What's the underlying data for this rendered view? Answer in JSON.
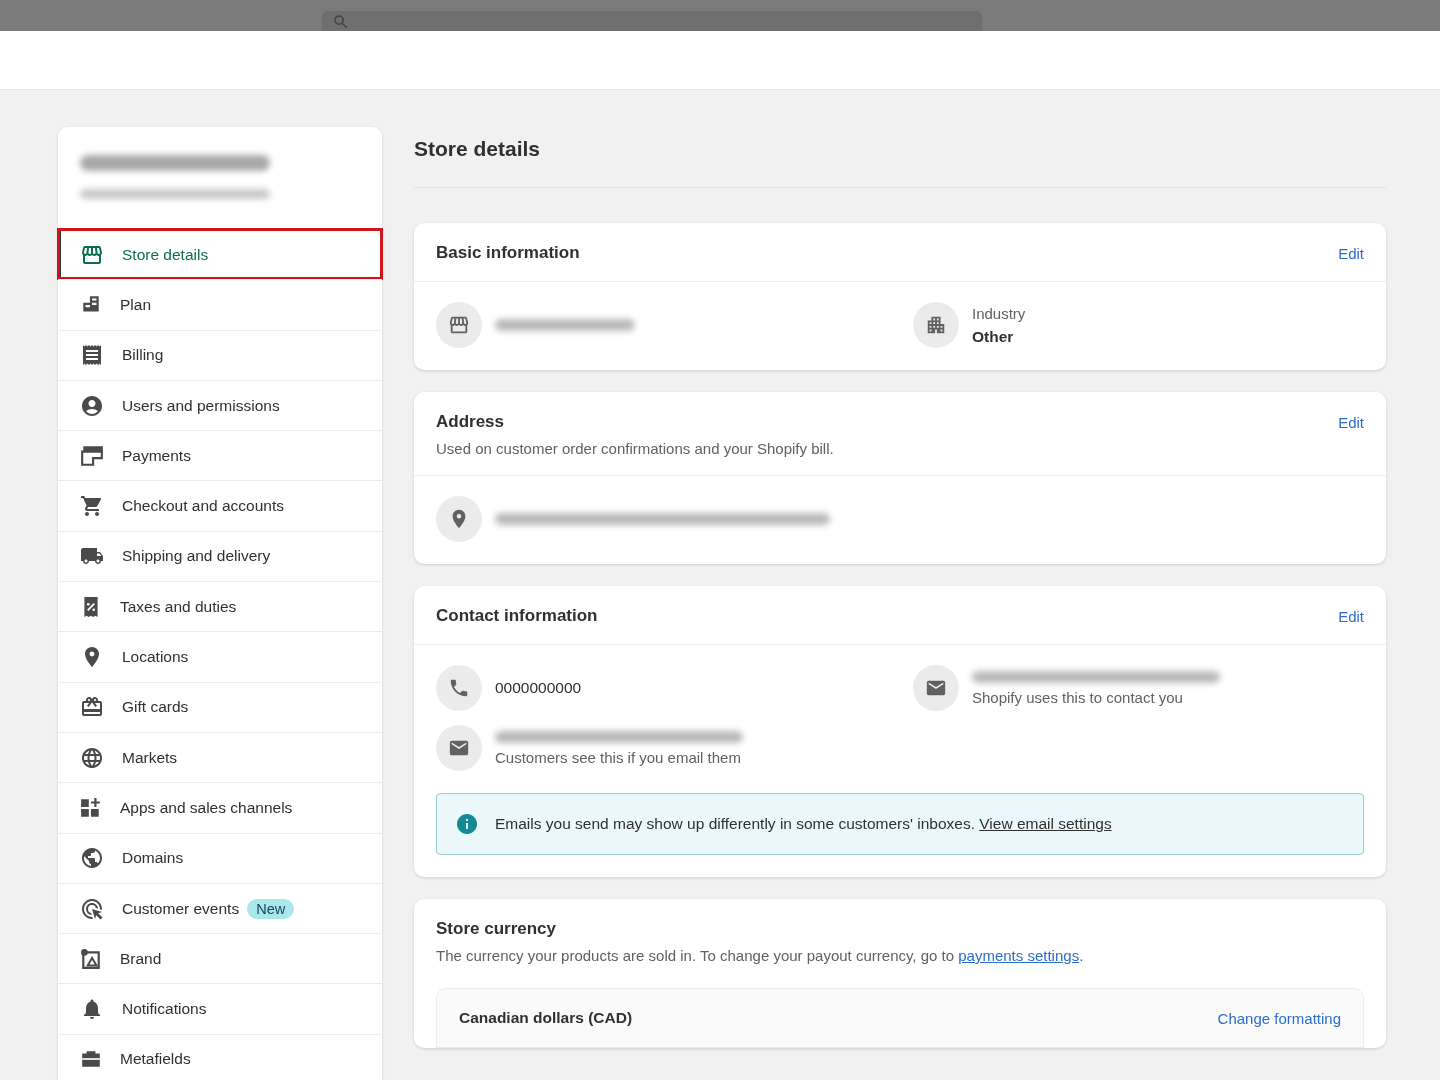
{
  "top_bar": {
    "search": {
      "kind": "cut"
    }
  },
  "sidebar": {
    "store": {
      "kind": "redacted"
    },
    "items": [
      {
        "label": "Store details",
        "selected": true,
        "highlighted": true
      },
      {
        "label": "Plan",
        "selected": false,
        "highlighted": false
      },
      {
        "label": "Billing",
        "selected": false,
        "highlighted": false
      },
      {
        "label": "Users and permissions",
        "selected": false,
        "highlighted": false
      },
      {
        "label": "Payments",
        "selected": false,
        "highlighted": false
      },
      {
        "label": "Checkout and accounts",
        "selected": false,
        "highlighted": false
      },
      {
        "label": "Shipping and delivery",
        "selected": false,
        "highlighted": false
      },
      {
        "label": "Taxes and duties",
        "selected": false,
        "highlighted": false
      },
      {
        "label": "Locations",
        "selected": false,
        "highlighted": false
      },
      {
        "label": "Gift cards",
        "selected": false,
        "highlighted": false
      },
      {
        "label": "Markets",
        "selected": false,
        "highlighted": false
      },
      {
        "label": "Apps and sales channels",
        "selected": false,
        "highlighted": false
      },
      {
        "label": "Domains",
        "selected": false,
        "highlighted": false
      },
      {
        "label": "Customer events",
        "badge": "New",
        "selected": false,
        "highlighted": false
      },
      {
        "label": "Brand",
        "selected": false,
        "highlighted": false
      },
      {
        "label": "Notifications",
        "selected": false,
        "highlighted": false
      },
      {
        "label": "Metafields",
        "selected": false,
        "highlighted": false
      }
    ]
  },
  "page_title": "Store details",
  "basic_information": {
    "title": "Basic information",
    "action": "Edit",
    "fields": [
      {
        "kind": "redacted"
      },
      {
        "kind": "labeled",
        "label": "Industry",
        "value": "Other"
      }
    ]
  },
  "address": {
    "title": "Address",
    "action": "Edit",
    "description": "Used on customer order confirmations and your Shopify bill.",
    "fields": [
      {
        "kind": "redacted"
      }
    ]
  },
  "contact_information": {
    "title": "Contact information",
    "action": "Edit",
    "fields": [
      {
        "kind": "plain",
        "value": "0000000000"
      },
      {
        "kind": "redacted",
        "note": "Shopify uses this to contact you"
      },
      {
        "kind": "redacted",
        "note": "Customers see this if you email them"
      }
    ],
    "notice": {
      "text": "Emails you send may show up differently in some customers' inboxes.",
      "link": "View email settings"
    }
  },
  "store_currency": {
    "title": "Store currency",
    "description": "The currency your products are sold in. To change your payout currency, go to",
    "link": "payments settings",
    "after_link": ".",
    "currency": "Canadian dollars (CAD)",
    "action": "Change formatting"
  }
}
